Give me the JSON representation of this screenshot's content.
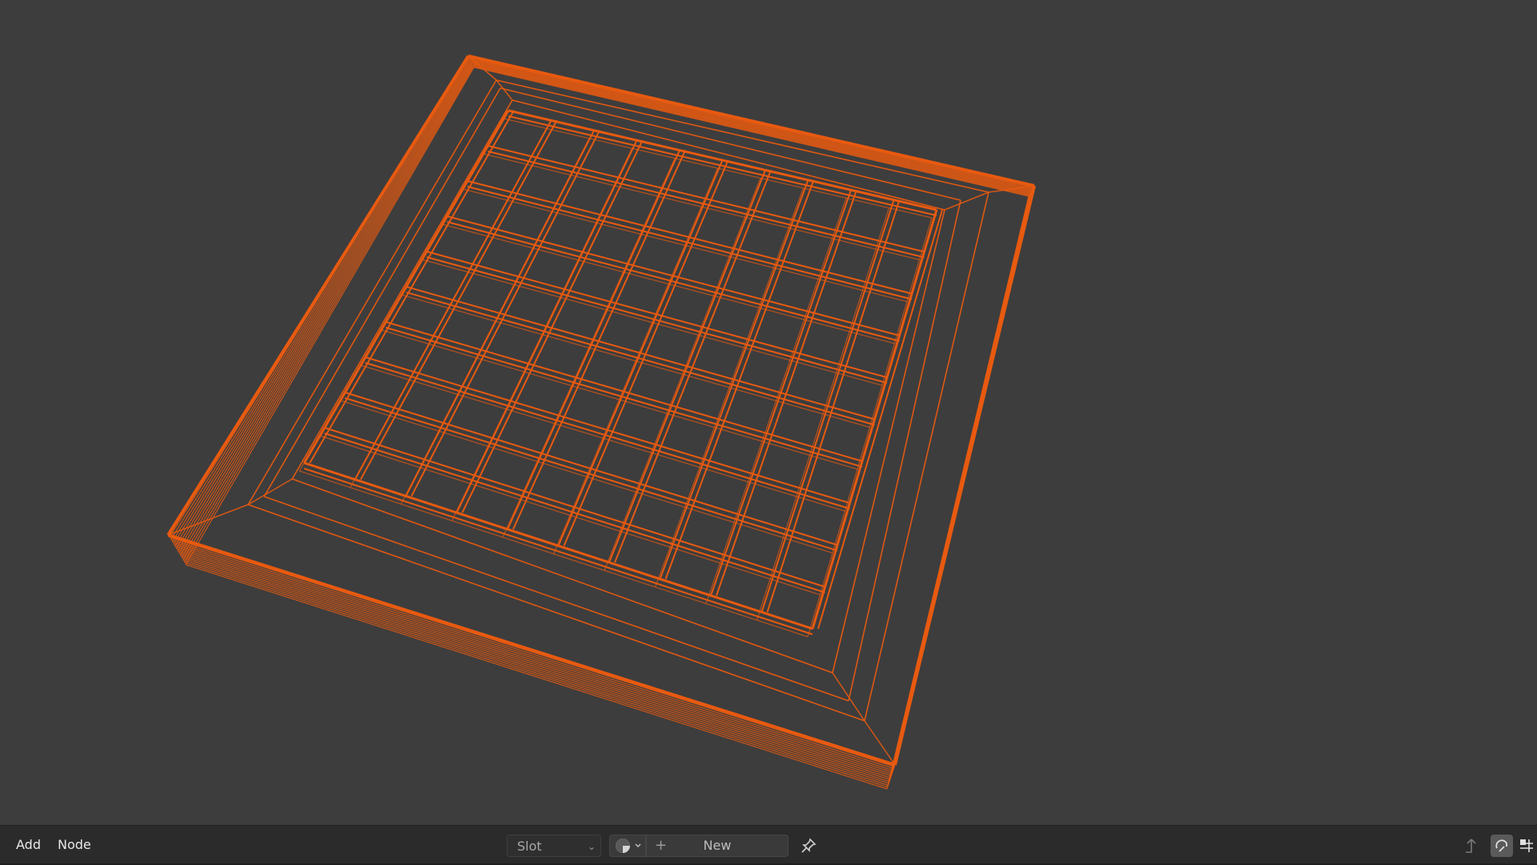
{
  "header": {
    "menu": {
      "add": "Add",
      "node": "Node"
    },
    "slot_label": "Slot",
    "new_label": "New"
  },
  "icons": {
    "material_preview": "sphere-half-icon",
    "add": "plus-icon",
    "pin": "pin-icon",
    "parent": "parent-arrow-icon",
    "snap": "snap-icon",
    "overlay": "grid-overlay-icon"
  },
  "colors": {
    "wireframe": "#e85a10",
    "background": "#3d3d3d",
    "header_bg": "#2b2b2b"
  }
}
